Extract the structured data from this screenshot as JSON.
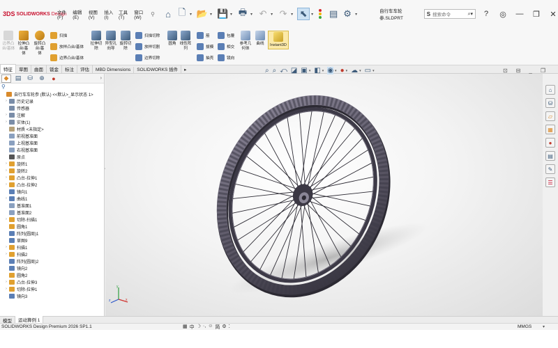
{
  "app": {
    "logo_ds": "3DS",
    "logo_text": "SOLIDWORKS",
    "logo_sub": "Design",
    "file_name": "自行车车轮参.SLDPRT",
    "search_placeholder": "搜索命令",
    "search_label": "S"
  },
  "menus": [
    "文件(F)",
    "编辑(E)",
    "视图(V)",
    "插入(I)",
    "工具(T)",
    "窗口(W)"
  ],
  "quick_access": [
    "home-icon",
    "new-icon",
    "open-icon",
    "save-icon",
    "print-icon",
    "undo-icon",
    "redo-icon",
    "select-icon",
    "rebuild-icon",
    "file-props-icon",
    "options-icon"
  ],
  "window_controls": [
    "help-icon",
    "minimize-icon",
    "restore-icon",
    "close-icon"
  ],
  "command_manager": {
    "left_buttons": [
      {
        "label": "拉伸凸\n台/基\n体",
        "key": "extrude-boss"
      },
      {
        "label": "旋转凸\n台/基\n体",
        "key": "revolve-boss"
      },
      {
        "label": "拉伸切\n除",
        "key": "extrude-cut"
      },
      {
        "label": "异型孔\n向导",
        "key": "hole-wizard"
      },
      {
        "label": "旋转切\n除",
        "key": "revolve-cut"
      },
      {
        "label": "圆角",
        "key": "fillet"
      },
      {
        "label": "线性阵\n列",
        "key": "linear-pattern"
      },
      {
        "label": "参考几\n何体",
        "key": "ref-geometry"
      },
      {
        "label": "曲线",
        "key": "curves"
      },
      {
        "label": "Instant3D",
        "key": "instant3d"
      }
    ],
    "disabled_label": "边界凸\n台/基体",
    "rows": [
      "扫描",
      "放样凸台/基体",
      "边界凸台/基体",
      "扫描切除",
      "放样切割",
      "边界切除",
      "筋",
      "拔模",
      "抽壳",
      "包覆",
      "相交",
      "镜向"
    ]
  },
  "tabs": [
    "特征",
    "草图",
    "曲面",
    "钣金",
    "标注",
    "评估",
    "MBD Dimensions",
    "SOLIDWORKS 插件"
  ],
  "active_tab": 0,
  "left_panel_tabs": [
    "feature-manager-icon",
    "property-manager-icon",
    "config-manager-icon",
    "dim-expert-icon",
    "display-manager-icon"
  ],
  "tree": [
    {
      "label": "自行车车轮参 (默认) <<默认>_显示状态 1>",
      "expand": "",
      "icon": "part-icon",
      "color": "#d98a2b",
      "indent": 0
    },
    {
      "label": "历史记录",
      "expand": "›",
      "icon": "history-icon",
      "color": "#7a8da8",
      "indent": 1
    },
    {
      "label": "传感器",
      "expand": "",
      "icon": "sensor-icon",
      "color": "#7a8da8",
      "indent": 1
    },
    {
      "label": "注解",
      "expand": "›",
      "icon": "annotation-icon",
      "color": "#7a8da8",
      "indent": 1
    },
    {
      "label": "实体(1)",
      "expand": "›",
      "icon": "solid-body-icon",
      "color": "#7a8da8",
      "indent": 1
    },
    {
      "label": "材质 <未指定>",
      "expand": "",
      "icon": "material-icon",
      "color": "#b5a17a",
      "indent": 1
    },
    {
      "label": "前视基准面",
      "expand": "",
      "icon": "plane-icon",
      "color": "#8aa0bf",
      "indent": 1
    },
    {
      "label": "上视基准面",
      "expand": "",
      "icon": "plane-icon",
      "color": "#8aa0bf",
      "indent": 1
    },
    {
      "label": "右视基准面",
      "expand": "",
      "icon": "plane-icon",
      "color": "#8aa0bf",
      "indent": 1
    },
    {
      "label": "原点",
      "expand": "",
      "icon": "origin-icon",
      "color": "#555555",
      "indent": 1
    },
    {
      "label": "旋转1",
      "expand": "›",
      "icon": "revolve-icon",
      "color": "#e0a030",
      "indent": 1
    },
    {
      "label": "旋转2",
      "expand": "›",
      "icon": "revolve-icon",
      "color": "#e0a030",
      "indent": 1
    },
    {
      "label": "凸台-拉伸1",
      "expand": "›",
      "icon": "extrude-icon",
      "color": "#e0a030",
      "indent": 1
    },
    {
      "label": "凸台-拉伸2",
      "expand": "›",
      "icon": "extrude-icon",
      "color": "#e0a030",
      "indent": 1
    },
    {
      "label": "镜向1",
      "expand": "",
      "icon": "mirror-icon",
      "color": "#5b7fb5",
      "indent": 1
    },
    {
      "label": "曲线1",
      "expand": "›",
      "icon": "curve-icon",
      "color": "#5b7fb5",
      "indent": 1
    },
    {
      "label": "基准面1",
      "expand": "",
      "icon": "plane-icon",
      "color": "#8aa0bf",
      "indent": 1
    },
    {
      "label": "基准面2",
      "expand": "",
      "icon": "plane-icon",
      "color": "#8aa0bf",
      "indent": 1
    },
    {
      "label": "切除-扫描1",
      "expand": "›",
      "icon": "sweep-cut-icon",
      "color": "#e0a030",
      "indent": 1
    },
    {
      "label": "圆角1",
      "expand": "",
      "icon": "fillet-icon",
      "color": "#e0a030",
      "indent": 1
    },
    {
      "label": "阵列(圆周)1",
      "expand": "",
      "icon": "circular-pattern-icon",
      "color": "#5b7fb5",
      "indent": 1
    },
    {
      "label": "草图9",
      "expand": "",
      "icon": "sketch-icon",
      "color": "#5b7fb5",
      "indent": 1
    },
    {
      "label": "扫描1",
      "expand": "›",
      "icon": "sweep-icon",
      "color": "#e0a030",
      "indent": 1
    },
    {
      "label": "扫描2",
      "expand": "›",
      "icon": "sweep-icon",
      "color": "#e0a030",
      "indent": 1
    },
    {
      "label": "阵列(圆周)2",
      "expand": "",
      "icon": "circular-pattern-icon",
      "color": "#5b7fb5",
      "indent": 1
    },
    {
      "label": "镜向2",
      "expand": "",
      "icon": "mirror-icon",
      "color": "#5b7fb5",
      "indent": 1
    },
    {
      "label": "圆角2",
      "expand": "",
      "icon": "fillet-icon",
      "color": "#e0a030",
      "indent": 1
    },
    {
      "label": "凸台-拉伸3",
      "expand": "›",
      "icon": "extrude-icon",
      "color": "#e0a030",
      "indent": 1
    },
    {
      "label": "切除-拉伸1",
      "expand": "›",
      "icon": "extrude-cut-icon",
      "color": "#e0a030",
      "indent": 1
    },
    {
      "label": "镜向3",
      "expand": "",
      "icon": "mirror-icon",
      "color": "#5b7fb5",
      "indent": 1
    }
  ],
  "task_pane": [
    "home-icon",
    "resources-icon",
    "design-library-icon",
    "file-explorer-icon",
    "appearances-icon",
    "custom-props-icon",
    "forum-icon",
    "solidworks-icon"
  ],
  "bottom_tabs": [
    "模型",
    "运动算例 1"
  ],
  "active_bottom_tab": 1,
  "status": {
    "product": "SOLIDWORKS Design Premium 2026 SP1.1",
    "units": "MMGS",
    "units_arrow": "▾"
  },
  "colors": {
    "brand_red": "#c8102e",
    "accent_blue": "#3d5b7a",
    "tire": "#5b5766",
    "rim": "#3d3a47"
  }
}
